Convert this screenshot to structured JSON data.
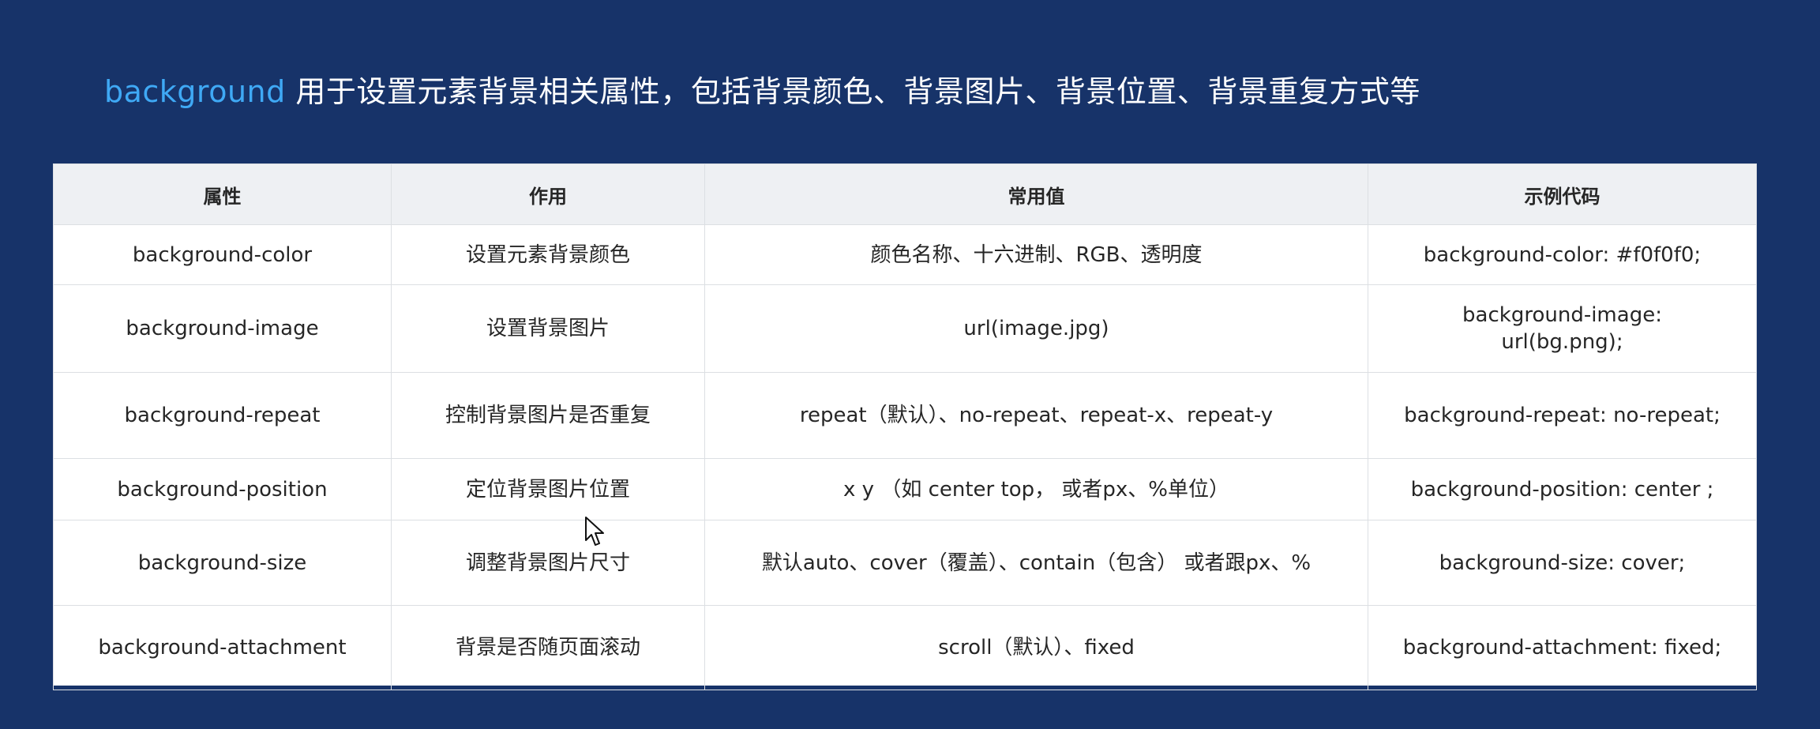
{
  "heading": {
    "keyword": "background",
    "text": " 用于设置元素背景相关属性，包括背景颜色、背景图片、背景位置、背景重复方式等"
  },
  "table": {
    "headers": [
      "属性",
      "作用",
      "常用值",
      "示例代码"
    ],
    "rows": [
      [
        "background-color",
        "设置元素背景颜色",
        "颜色名称、十六进制、RGB、透明度",
        "background-color: #f0f0f0;"
      ],
      [
        "background-image",
        "设置背景图片",
        "url(image.jpg)",
        "background-image:",
        "url(bg.png);"
      ],
      [
        "background-repeat",
        "控制背景图片是否重复",
        "repeat（默认）、no-repeat、repeat-x、repeat-y",
        "background-repeat: no-repeat;"
      ],
      [
        "background-position",
        "定位背景图片位置",
        "x y （如 center top， 或者px、%单位）",
        "background-position: center ;"
      ],
      [
        "background-size",
        "调整背景图片尺寸",
        "默认auto、cover（覆盖）、contain（包含） 或者跟px、%",
        "background-size: cover;"
      ],
      [
        "background-attachment",
        "背景是否随页面滚动",
        "scroll（默认）、fixed",
        "background-attachment: fixed;"
      ]
    ]
  },
  "icons": {
    "cursor": "mouse-pointer-icon"
  }
}
